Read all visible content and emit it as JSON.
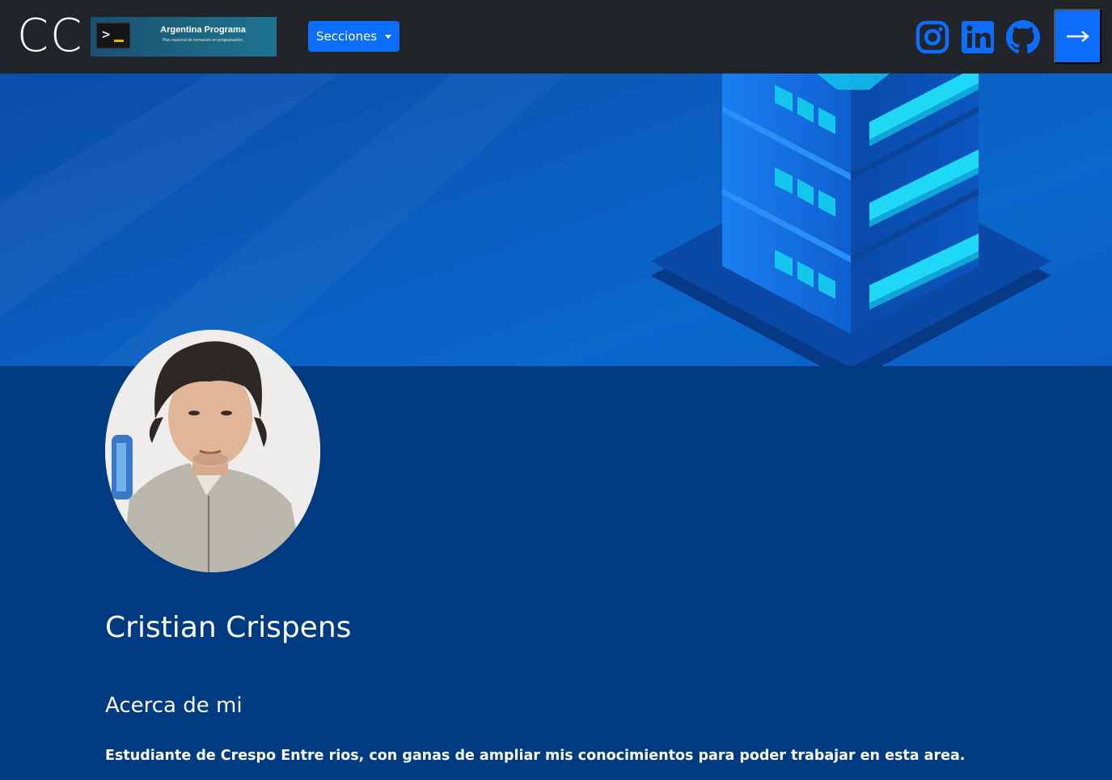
{
  "navbar": {
    "brand": "CC",
    "logo": {
      "prompt": ">",
      "title": "Argentina Programa",
      "subtitle": "Plan nacional de formación en programación."
    },
    "sections_button": "Secciones",
    "social_icons": [
      "instagram-icon",
      "linkedin-icon",
      "github-icon"
    ],
    "login_icon": "arrow-right-icon",
    "colors": {
      "bar": "#212529",
      "primary": "#0d6efd",
      "social": "#0d6efd"
    }
  },
  "banner": {
    "colors": {
      "bg": "#0b5cbd",
      "cyan": "#1fd8f5"
    }
  },
  "profile": {
    "name": "Cristian Crispens",
    "about_heading": "Acerca de mi",
    "about_text": "Estudiante de Crespo Entre rios, con ganas de ampliar mis conocimientos para poder trabajar en esta area."
  },
  "colors": {
    "page_bg": "#003a80"
  }
}
